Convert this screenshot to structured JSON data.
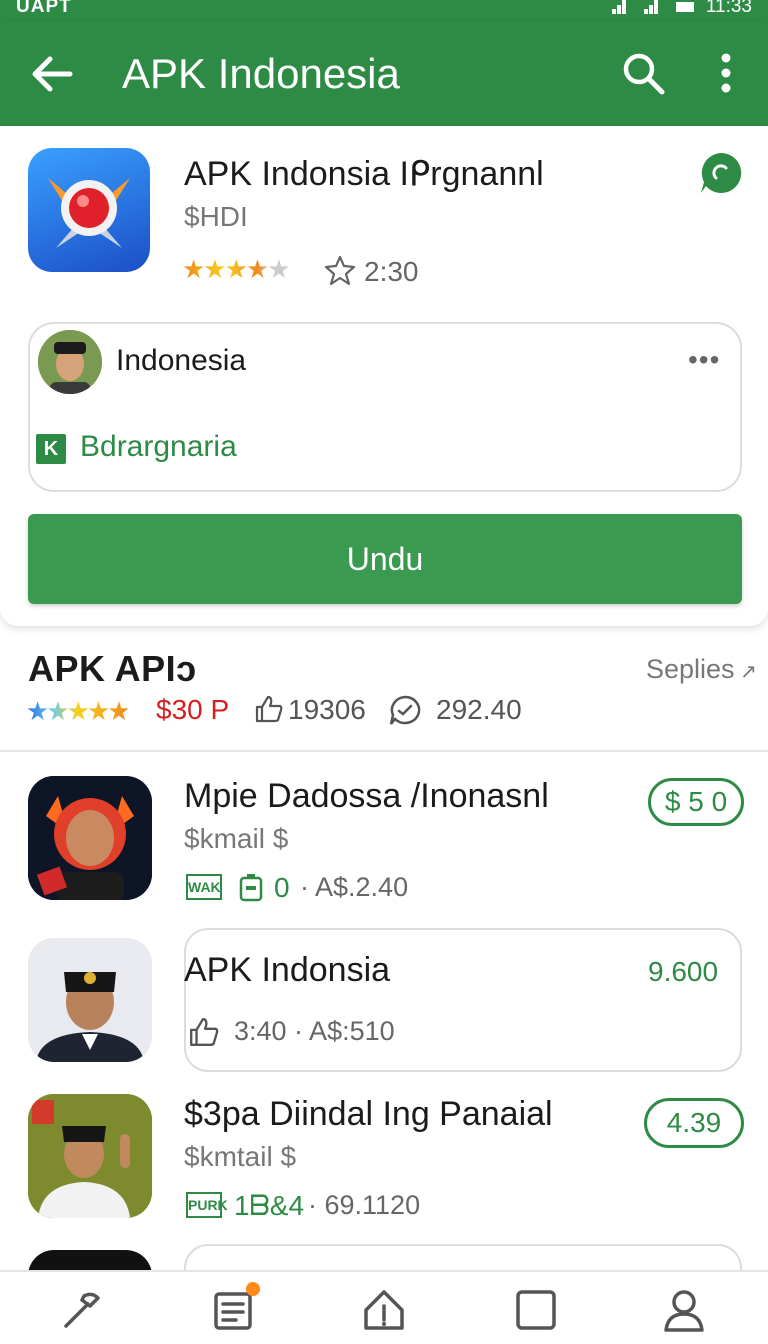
{
  "status_bar": {
    "carrier": "UAPT",
    "time": "11:33"
  },
  "app_bar": {
    "title": "APK Indonesia",
    "icons": [
      "back-arrow-icon",
      "search-icon",
      "more-vert-icon"
    ]
  },
  "featured": {
    "name": "APK Indonsia Iᑭrgnannl",
    "subtitle": "$HDI",
    "stars": "★★★★★",
    "rating_text": "2:30",
    "dev": {
      "name": "Indonesia",
      "more": "•••",
      "category_icon": "K",
      "category": "Bdrargnaria"
    },
    "download_label": "Undu"
  },
  "section": {
    "title": "APK APIↄ",
    "link": "Seplies",
    "stars": "★★★★★",
    "price": "$30 P",
    "likes": "19306",
    "comments": "292.40"
  },
  "list": [
    {
      "name": "Mpie Dadossa /Inonasnl",
      "subtitle": "$kmail $",
      "tag": "WAK",
      "meta_green": "0",
      "meta": "· A$.2.40",
      "price": "$ 5 0"
    },
    {
      "name": "APK Indonsia",
      "meta": "3:40 · A$:510",
      "price": "9.600"
    },
    {
      "name": "$3pa Diindal Ing Panaial",
      "subtitle": "$kmtail $",
      "tag": "PURK",
      "meta_green": "1ᗷ&4",
      "meta": "· 69.1120",
      "price": "4.39"
    }
  ],
  "bottom_nav": [
    "tools-icon",
    "list-icon",
    "home-icon",
    "square-icon",
    "profile-icon"
  ],
  "colors": {
    "primary": "#2e8b45",
    "button": "#3a9a50",
    "price_red": "#d62020",
    "badge": "#ff8a1a"
  }
}
